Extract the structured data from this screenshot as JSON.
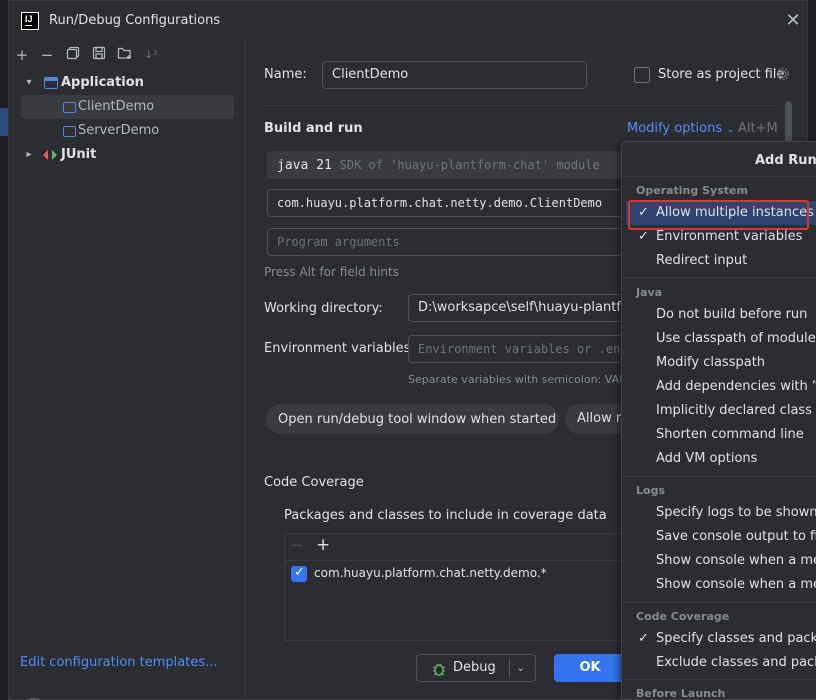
{
  "window": {
    "title": "Run/Debug Configurations"
  },
  "tree": {
    "application_label": "Application",
    "items": [
      "ClientDemo",
      "ServerDemo"
    ],
    "junit_label": "JUnit"
  },
  "left": {
    "edit_templates": "Edit configuration templates...",
    "help": "?"
  },
  "form": {
    "name_label": "Name:",
    "name_value": "ClientDemo",
    "store_label": "Store as project file",
    "build_run_title": "Build and run",
    "modify_options": "Modify options",
    "modify_shortcut": "Alt+M",
    "jdk_main": "java 21",
    "jdk_sub": "SDK of 'huayu-plantform-chat' module",
    "main_class": "com.huayu.platform.chat.netty.demo.ClientDemo",
    "program_args_placeholder": "Program arguments",
    "field_hint": "Press Alt for field hints",
    "working_dir_label": "Working directory:",
    "working_dir_value": "D:\\worksapce\\self\\huayu-plantform",
    "env_label": "Environment variables:",
    "env_placeholder": "Environment variables or .env",
    "env_hint": "Separate variables with semicolon: VAR=",
    "chip_open": "Open run/debug tool window when started",
    "chip_allow": "Allow m",
    "coverage_title": "Code Coverage",
    "coverage_packages_label": "Packages and classes to include in coverage data",
    "coverage_entry": "com.huayu.platform.chat.netty.demo.*"
  },
  "buttons": {
    "debug": "Debug",
    "ok": "OK"
  },
  "popup": {
    "title": "Add Run O",
    "groups": {
      "os": "Operating System",
      "java": "Java",
      "logs": "Logs",
      "coverage": "Code Coverage",
      "before": "Before Launch"
    },
    "os_items": [
      "Allow multiple instances",
      "Environment variables",
      "Redirect input"
    ],
    "java_items": [
      "Do not build before run",
      "Use classpath of module",
      "Modify classpath",
      "Add dependencies with “pro",
      "Implicitly declared class run",
      "Shorten command line",
      "Add VM options"
    ],
    "logs_items": [
      "Specify logs to be shown in",
      "Save console output to file",
      "Show console when a messa",
      "Show console when a messa"
    ],
    "coverage_items": [
      "Specify classes and packag",
      "Exclude classes and packag"
    ]
  },
  "colors": {
    "accent": "#3574f0",
    "link": "#548af7",
    "highlight_box": "#e0332f"
  }
}
